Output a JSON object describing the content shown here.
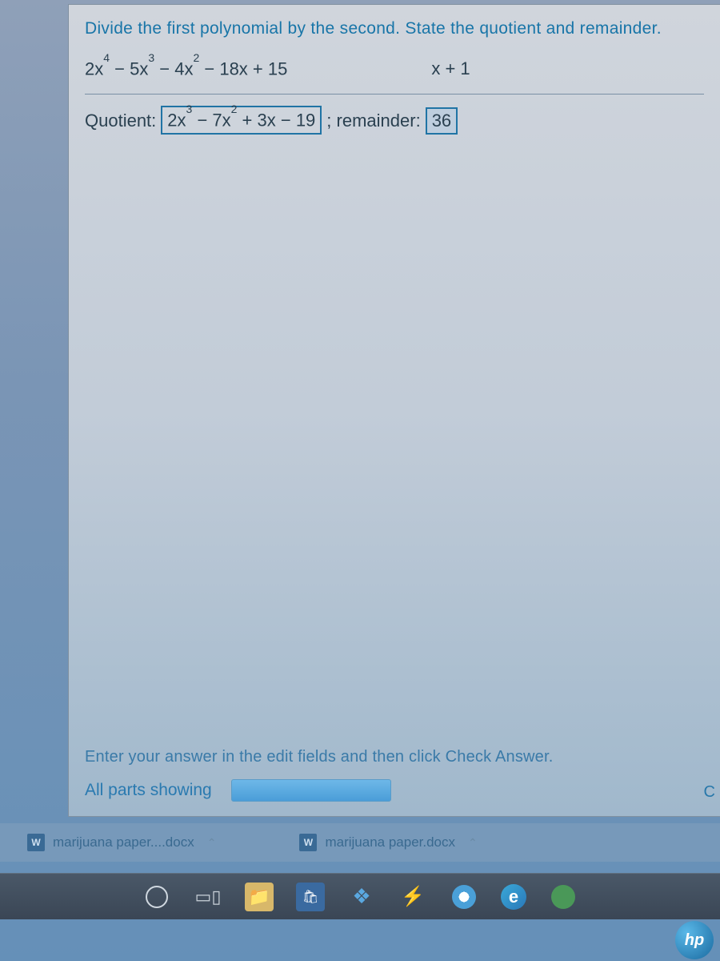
{
  "problem": {
    "instruction": "Divide the first polynomial by the second. State the quotient and remainder.",
    "dividend_html": "2x<sup>4</sup> − 5x<sup>3</sup> − 4x<sup>2</sup> − 18x + 15",
    "divisor_html": "x + 1",
    "quotient_label": "Quotient:",
    "quotient_answer_html": "2x<sup>3</sup> − 7x<sup>2</sup> + 3x − 19",
    "remainder_label": "; remainder:",
    "remainder_answer": "36"
  },
  "footer": {
    "hint": "Enter your answer in the edit fields and then click Check Answer.",
    "all_parts": "All parts showing",
    "corner_letter": "C"
  },
  "downloads": [
    {
      "icon": "W",
      "name": "marijuana paper....docx"
    },
    {
      "icon": "W",
      "name": "marijuana paper.docx"
    }
  ],
  "taskbar": {
    "items": [
      "cortana",
      "taskview",
      "explorer",
      "store",
      "dropbox",
      "bolt",
      "chrome",
      "edge",
      "green"
    ]
  },
  "hp": "hp"
}
